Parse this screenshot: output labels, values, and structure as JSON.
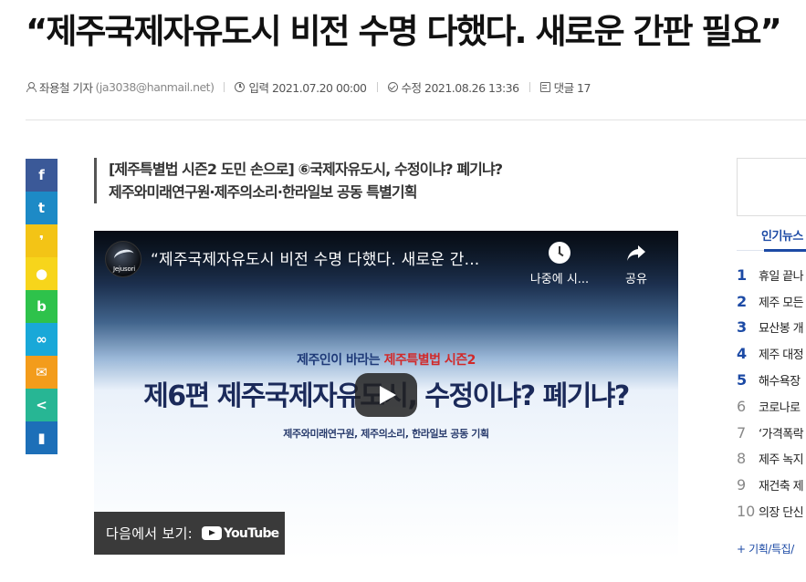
{
  "article": {
    "headline": "“제주국제자유도시 비전 수명 다했다. 새로운 간판 필요”",
    "meta": {
      "author": "좌용철 기자",
      "email": "(ja3038@hanmail.net)",
      "published": "입력 2021.07.20 00:00",
      "modified": "수정 2021.08.26 13:36",
      "comments": "댓글 17"
    },
    "subtitle_line1": "[제주특별법 시즌2 도민 손으로] ⑥국제자유도시, 수정이냐? 폐기냐?",
    "subtitle_line2": "제주와미래연구원·제주의소리·한라일보 공동 특별기획"
  },
  "share": {
    "buttons": [
      {
        "name": "facebook",
        "color": "#3b5998",
        "glyph": "f"
      },
      {
        "name": "twitter",
        "color": "#1d8ac6",
        "glyph": "t"
      },
      {
        "name": "kakaostory",
        "color": "#f3c416",
        "glyph": "❜"
      },
      {
        "name": "kakaotalk",
        "color": "#f7d51b",
        "glyph": "●"
      },
      {
        "name": "band",
        "color": "#2ec24b",
        "glyph": "b"
      },
      {
        "name": "link",
        "color": "#19a8d8",
        "glyph": "∞"
      },
      {
        "name": "email",
        "color": "#f39c1b",
        "glyph": "✉"
      },
      {
        "name": "share",
        "color": "#27b694",
        "glyph": "<"
      },
      {
        "name": "bookmark",
        "color": "#1d6fb8",
        "glyph": "▮"
      }
    ]
  },
  "video": {
    "channel": "Jejusori",
    "title": "“제주국제자유도시 비전 수명 다했다. 새로운 간...",
    "watch_later": "나중에 시...",
    "share": "공유",
    "slide_top_prefix": "제주인이 바라는 ",
    "slide_top_highlight": "제주특별법 시즌2",
    "slide_main": "제6편 제주국제자유도시, 수정이냐? 폐기냐?",
    "slide_sub": "제주와미래연구원, 제주의소리, 한라일보 공동 기획",
    "watch_on": "다음에서 보기:",
    "youtube": "YouTube"
  },
  "sidebar": {
    "popular_tab": "인기뉴스",
    "items": [
      {
        "rank": "1",
        "text": "휴일 끝나"
      },
      {
        "rank": "2",
        "text": "제주 모든"
      },
      {
        "rank": "3",
        "text": "묘산봉 개"
      },
      {
        "rank": "4",
        "text": "제주 대정"
      },
      {
        "rank": "5",
        "text": "해수욕장"
      },
      {
        "rank": "6",
        "text": "코로나로"
      },
      {
        "rank": "7",
        "text": "‘가격폭락"
      },
      {
        "rank": "8",
        "text": "제주 녹지"
      },
      {
        "rank": "9",
        "text": "재건축 제"
      },
      {
        "rank": "10",
        "text": "의장 단신"
      }
    ],
    "more": "+ 기획/특집/"
  }
}
